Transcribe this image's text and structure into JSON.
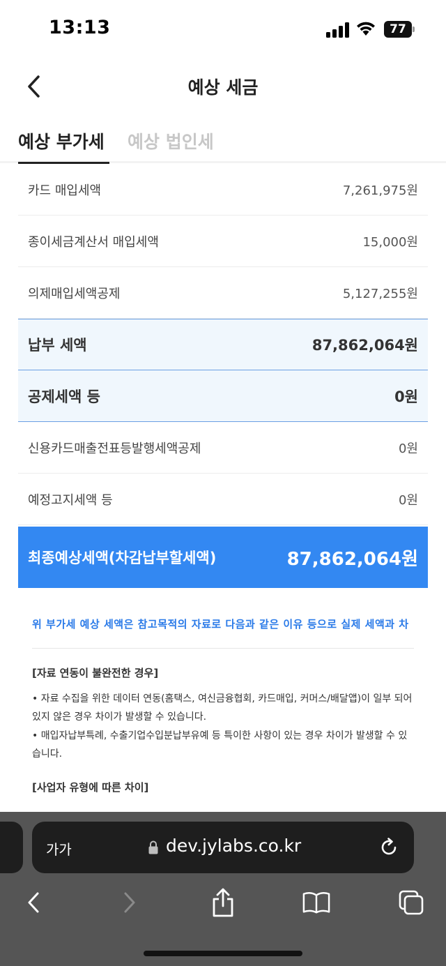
{
  "status_bar": {
    "time": "13:13",
    "battery": "77"
  },
  "header": {
    "title": "예상 세금"
  },
  "tabs": [
    {
      "label": "예상 부가세",
      "active": true
    },
    {
      "label": "예상 법인세",
      "active": false
    }
  ],
  "rows": [
    {
      "label": "카드 매입세액",
      "value": "7,261,975원"
    },
    {
      "label": "종이세금계산서 매입세액",
      "value": "15,000원"
    },
    {
      "label": "의제매입세액공제",
      "value": "5,127,255원"
    },
    {
      "label": "납부 세액",
      "value": "87,862,064원",
      "highlight": true
    },
    {
      "label": "공제세액 등",
      "value": "0원",
      "highlight": true
    },
    {
      "label": "신용카드매출전표등발행세액공제",
      "value": "0원"
    },
    {
      "label": "예정고지세액 등",
      "value": "0원"
    }
  ],
  "final": {
    "label": "최종예상세액(차감납부할세액)",
    "value": "87,862,064원"
  },
  "notice": "위 부가세 예상 세액은 참고목적의 자료로 다음과 같은 이유 등으로 실제 세액과 차",
  "sections": [
    {
      "title": "[자료 연동이 불완전한 경우]",
      "bullets": [
        "•  자료 수집을 위한 데이터 연동(홈택스, 여신금융협회, 카드매입, 커머스/배달앱)이 일부 되어 있지 않은 경우 차이가 발생할 수 있습니다.",
        "•  매입자납부특례, 수출기업수입분납부유예 등 특이한 사항이 있는 경우 차이가 발생할 수 있습니다."
      ]
    },
    {
      "title": "[사업자 유형에 따른 차이]",
      "bullets": []
    }
  ],
  "browser": {
    "text_size_label": "가가",
    "url": "dev.jylabs.co.kr"
  },
  "colors": {
    "accent": "#3388f2",
    "notice": "#2a7ae8",
    "summary_bg": "#f0f7fd",
    "summary_border": "#6a9fe3"
  }
}
